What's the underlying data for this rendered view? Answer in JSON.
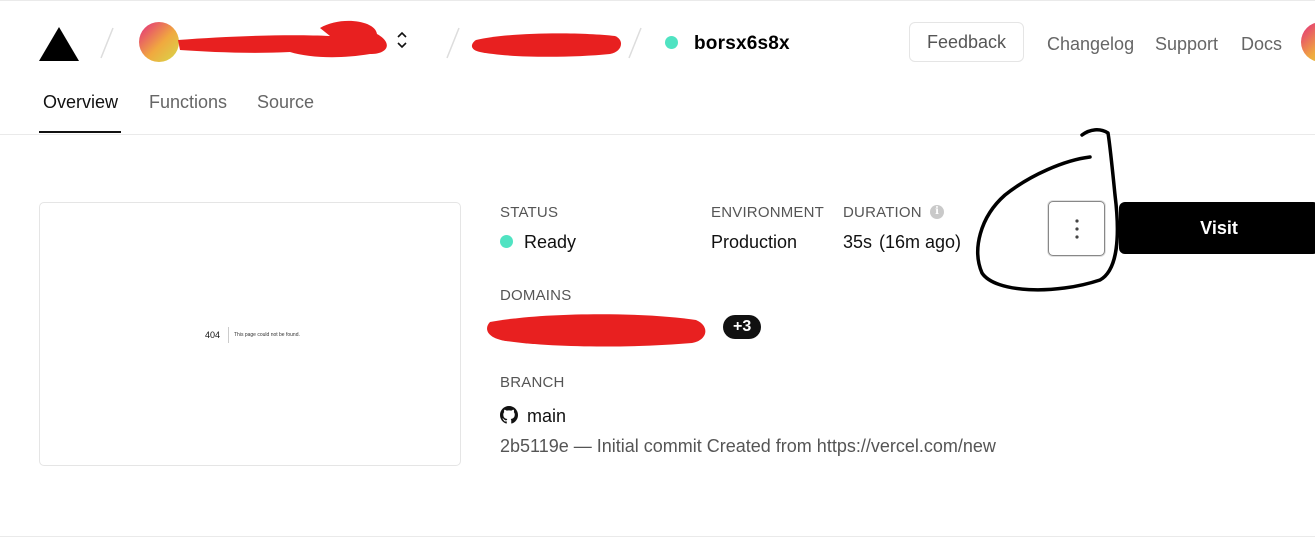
{
  "header": {
    "deployment_id": "borsx6s8x",
    "actions": {
      "feedback": "Feedback"
    },
    "nav": [
      "Changelog",
      "Support",
      "Docs"
    ]
  },
  "tabs": [
    "Overview",
    "Functions",
    "Source"
  ],
  "preview": {
    "code": "404",
    "message": "This page could not be found."
  },
  "details": {
    "status": {
      "label": "STATUS",
      "value": "Ready"
    },
    "environment": {
      "label": "ENVIRONMENT",
      "value": "Production"
    },
    "duration": {
      "label": "DURATION",
      "value": "35s",
      "ago": "(16m ago)",
      "info_icon": "info-icon"
    },
    "domains": {
      "label": "DOMAINS",
      "more_count": "+3"
    },
    "branch": {
      "label": "BRANCH",
      "name": "main",
      "icon": "github-icon",
      "commit": "2b5119e — Initial commit Created from https://vercel.com/new"
    }
  },
  "buttons": {
    "more": "more-options",
    "visit": "Visit"
  },
  "colors": {
    "ready": "#50e3c2",
    "redaction": "#e82020",
    "primary": "#000000"
  }
}
